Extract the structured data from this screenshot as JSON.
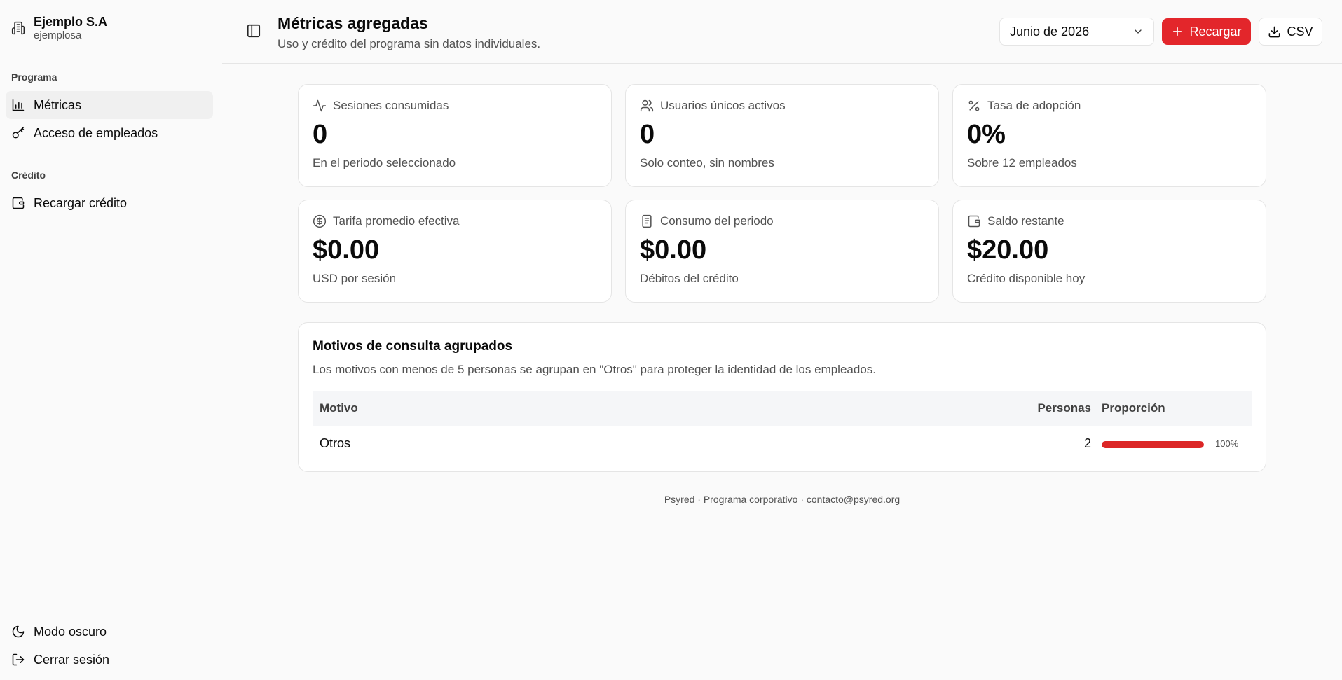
{
  "sidebar": {
    "brand_name": "Ejemplo S.A",
    "brand_handle": "ejemplosa",
    "section_program": "Programa",
    "section_credit": "Crédito",
    "items": {
      "metrics": "Métricas",
      "employee_access": "Acceso de empleados",
      "recharge_credit": "Recargar crédito",
      "dark_mode": "Modo oscuro",
      "logout": "Cerrar sesión"
    },
    "active_item": "metrics"
  },
  "header": {
    "title": "Métricas agregadas",
    "subtitle": "Uso y crédito del programa sin datos individuales.",
    "month_selected": "Junio de 2026",
    "reload_label": "Recargar",
    "csv_label": "CSV"
  },
  "cards": {
    "sessions": {
      "label": "Sesiones consumidas",
      "value": "0",
      "note": "En el periodo seleccionado",
      "icon": "activity-icon"
    },
    "users": {
      "label": "Usuarios únicos activos",
      "value": "0",
      "note": "Solo conteo, sin nombres",
      "icon": "users-icon"
    },
    "adoption": {
      "label": "Tasa de adopción",
      "value": "0%",
      "note": "Sobre 12 empleados",
      "icon": "percent-icon"
    },
    "rate": {
      "label": "Tarifa promedio efectiva",
      "value": "$0.00",
      "note": "USD por sesión",
      "icon": "dollar-circle-icon"
    },
    "consumption": {
      "label": "Consumo del periodo",
      "value": "$0.00",
      "note": "Débitos del crédito",
      "icon": "receipt-icon"
    },
    "balance": {
      "label": "Saldo restante",
      "value": "$20.00",
      "note": "Crédito disponible hoy",
      "icon": "wallet-icon"
    }
  },
  "motivos": {
    "title": "Motivos de consulta agrupados",
    "description": "Los motivos con menos de 5 personas se agrupan en \"Otros\" para proteger la identidad de los empleados.",
    "columns": {
      "motivo": "Motivo",
      "personas": "Personas",
      "proporcion": "Proporción"
    },
    "rows": [
      {
        "motivo": "Otros",
        "personas": "2",
        "proportion": 1.0,
        "proportion_label": "100%"
      }
    ]
  },
  "footer": "Psyred · Programa corporativo · contacto@psyred.org",
  "colors": {
    "accent": "#e3262b",
    "bar": "#dc2626"
  }
}
